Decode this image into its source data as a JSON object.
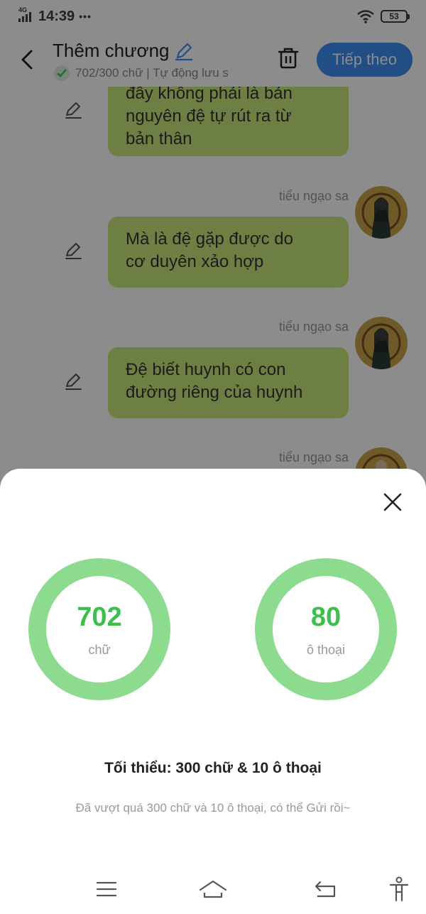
{
  "status_bar": {
    "time": "14:39",
    "dots": "•••",
    "network": "4G",
    "battery": "53"
  },
  "header": {
    "title": "Thêm chương",
    "subtitle": "702/300 chữ | Tự động lưu s",
    "next_label": "Tiếp theo"
  },
  "chat": {
    "messages": [
      {
        "text_line1": "đây không phải là bản",
        "text_line2": "nguyên đệ tự rút ra từ",
        "text_line3": "bản thân"
      },
      {
        "author": "tiểu ngạo sa",
        "text_line1": "Mà là đệ gặp được do",
        "text_line2": "cơ duyên xảo hợp"
      },
      {
        "author": "tiểu ngạo sa",
        "text_line1": "Đệ biết huynh có con",
        "text_line2": "đường riêng của huynh"
      },
      {
        "author": "tiểu ngạo sa"
      }
    ]
  },
  "sheet": {
    "word_count": "702",
    "word_unit": "chữ",
    "dialog_count": "80",
    "dialog_unit": "ô thoại",
    "requirement": "Tối thiểu: 300 chữ & 10 ô thoại",
    "hint": "Đã vượt quá 300 chữ và 10 ô thoại, có thể Gửi rồi~"
  },
  "colors": {
    "accent_blue": "#3d8ef0",
    "bubble_green": "#c7e878",
    "ring_green": "#8cdb8f",
    "count_green": "#3cbf4c"
  },
  "icons": {
    "back": "chevron-left-icon",
    "edit": "pencil-icon",
    "trash": "trash-icon",
    "check": "check-icon",
    "close": "close-icon",
    "nav_menu": "menu-icon",
    "nav_home": "home-icon",
    "nav_back": "return-icon",
    "accessibility": "accessibility-icon"
  }
}
